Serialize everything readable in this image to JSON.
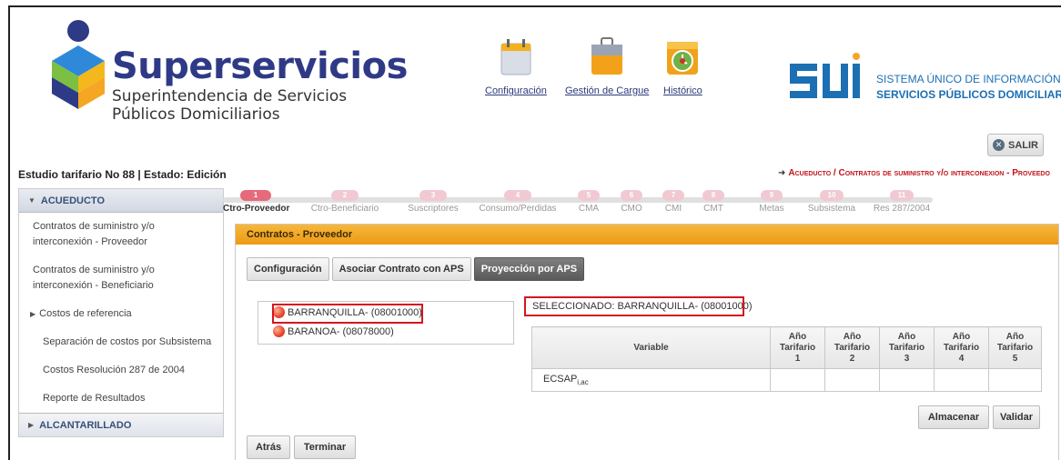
{
  "header": {
    "brand_title": "Superservicios",
    "brand_sub_line1": "Superintendencia de Servicios",
    "brand_sub_line2": "Públicos Domiciliarios",
    "toolbar": [
      {
        "label": "Configuración",
        "icon": "calendar-icon"
      },
      {
        "label": "Gestión de Cargue",
        "icon": "briefcase-icon"
      },
      {
        "label": "Histórico",
        "icon": "history-folder-icon"
      }
    ],
    "sui_line1": "SISTEMA ÚNICO DE INFORMACIÓN DE",
    "sui_line2": "SERVICIOS PÚBLICOS DOMICILIARIOS",
    "logout_label": "SALIR"
  },
  "study_title": "Estudio tarifario No 88 | Estado: Edición",
  "breadcrumb": "Acueducto / Contratos de suministro y/o interconexion - Proveedo",
  "sidebar": {
    "section_title": "ACUEDUCTO",
    "items": [
      {
        "label": "Contratos de suministro y/o interconexión - Proveedor"
      },
      {
        "label": "Contratos de suministro y/o interconexión - Beneficiario"
      },
      {
        "label": "Costos de referencia"
      },
      {
        "label": "Separación de costos por Subsistema"
      },
      {
        "label": "Costos Resolución 287 de 2004"
      },
      {
        "label": "Reporte de Resultados"
      }
    ],
    "footer_title": "ALCANTARILLADO"
  },
  "steps": [
    {
      "num": "1",
      "label": "Ctro-Proveedor"
    },
    {
      "num": "2",
      "label": "Ctro-Beneficiario"
    },
    {
      "num": "3",
      "label": "Suscriptores"
    },
    {
      "num": "4",
      "label": "Consumo/Perdidas"
    },
    {
      "num": "5",
      "label": "CMA"
    },
    {
      "num": "6",
      "label": "CMO"
    },
    {
      "num": "7",
      "label": "CMI"
    },
    {
      "num": "8",
      "label": "CMT"
    },
    {
      "num": "9",
      "label": "Metas"
    },
    {
      "num": "10",
      "label": "Subsistema"
    },
    {
      "num": "11",
      "label": "Res 287/2004"
    }
  ],
  "panel": {
    "title": "Contratos - Proveedor",
    "tabs": [
      "Configuración",
      "Asociar Contrato con APS",
      "Proyección por APS"
    ],
    "tree": [
      "BARRANQUILLA- (08001000)",
      "BARANOA- (08078000)"
    ],
    "selected": "SELECCIONADO: BARRANQUILLA- (08001000)",
    "table": {
      "variable_header": "Variable",
      "year_headers": [
        {
          "l1": "Año",
          "l2": "Tarifario",
          "l3": "1"
        },
        {
          "l1": "Año",
          "l2": "Tarifario",
          "l3": "2"
        },
        {
          "l1": "Año",
          "l2": "Tarifario",
          "l3": "3"
        },
        {
          "l1": "Año",
          "l2": "Tarifario",
          "l3": "4"
        },
        {
          "l1": "Año",
          "l2": "Tarifario",
          "l3": "5"
        }
      ],
      "row_var": "ECSAP",
      "row_var_sub": "i,ac"
    },
    "save_label": "Almacenar",
    "validate_label": "Validar",
    "back_label": "Atrás",
    "finish_label": "Terminar"
  },
  "colors": {
    "brand_blue": "#2f3a86",
    "panel_orange": "#ec9a16",
    "highlight_red": "#d4161f",
    "step_active": "#e56a7b"
  }
}
